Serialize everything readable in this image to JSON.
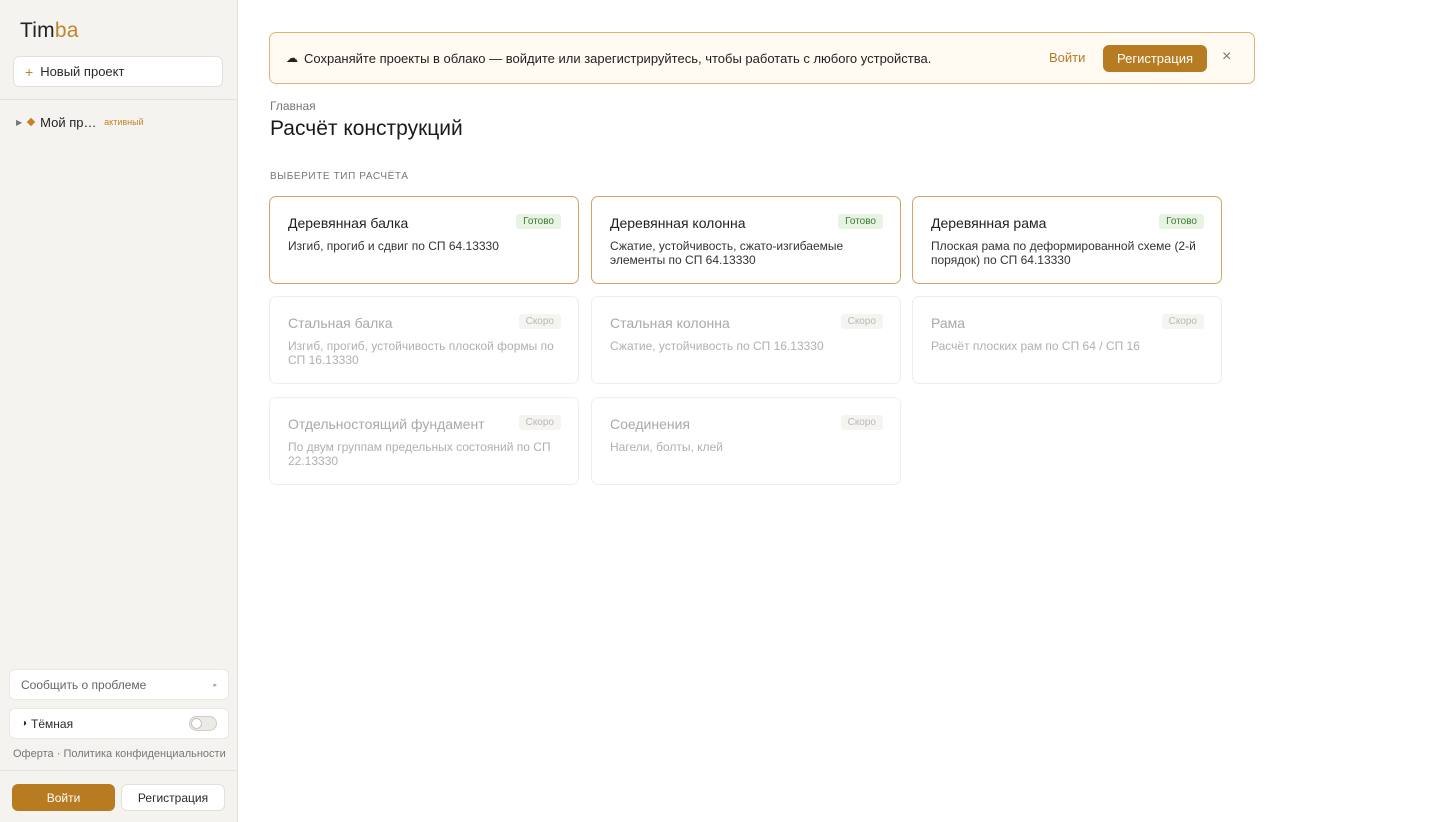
{
  "app": {
    "logo_main": "Tim",
    "logo_accent": "ba"
  },
  "sidebar": {
    "new_project_label": "Новый проект",
    "projects": [
      {
        "name": "Мой пр…",
        "badge": "активный"
      }
    ],
    "report_label": "Сообщить о проблеме",
    "dark_mode_label": "Тёмная",
    "dark_mode_on": false,
    "legal": {
      "offer": "Оферта",
      "separator": "·",
      "privacy": "Политика конфиденциальности"
    },
    "login_label": "Войти",
    "register_label": "Регистрация"
  },
  "banner": {
    "icon": "cloud-icon",
    "message": "Сохраняйте проекты в облако — войдите или зарегистрируйтесь, чтобы работать с любого устройства.",
    "login_label": "Войти",
    "register_label": "Регистрация",
    "close_symbol": "×"
  },
  "header": {
    "breadcrumb": "Главная",
    "title": "Расчёт конструкций",
    "section_label": "Выберите тип расчёта"
  },
  "cards": [
    {
      "title": "Деревянная балка",
      "desc": "Изгиб, прогиб и сдвиг по СП 64.13330",
      "badge": "Готово",
      "status": "ready"
    },
    {
      "title": "Деревянная колонна",
      "desc": "Сжатие, устойчивость, сжато-изгибаемые элементы по СП 64.13330",
      "badge": "Готово",
      "status": "ready"
    },
    {
      "title": "Деревянная рама",
      "desc": "Плоская рама по деформированной схеме (2-й порядок) по СП 64.13330",
      "badge": "Готово",
      "status": "ready"
    },
    {
      "title": "Стальная балка",
      "desc": "Изгиб, прогиб, устойчивость плоской формы по СП 16.13330",
      "badge": "Скоро",
      "status": "soon"
    },
    {
      "title": "Стальная колонна",
      "desc": "Сжатие, устойчивость по СП 16.13330",
      "badge": "Скоро",
      "status": "soon"
    },
    {
      "title": "Рама",
      "desc": "Расчёт плоских рам по СП 64 / СП 16",
      "badge": "Скоро",
      "status": "soon"
    },
    {
      "title": "Отдельностоящий фундамент",
      "desc": "По двум группам предельных состояний по СП 22.13330",
      "badge": "Скоро",
      "status": "soon"
    },
    {
      "title": "Соединения",
      "desc": "Нагели, болты, клей",
      "badge": "Скоро",
      "status": "soon"
    }
  ],
  "colors": {
    "accent": "#b77b22",
    "ready_badge_bg": "#e7f3e3",
    "ready_badge_text": "#3d7a33",
    "ready_card_border": "#d8a26a"
  }
}
